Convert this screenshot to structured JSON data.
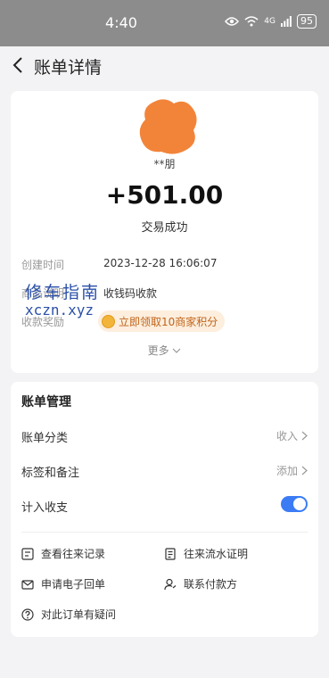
{
  "status_bar": {
    "time": "4:40",
    "network": "4G",
    "battery": "95"
  },
  "header": {
    "title": "账单详情"
  },
  "transaction": {
    "payer": "**朋",
    "amount": "+501.00",
    "status": "交易成功",
    "details": [
      {
        "label": "创建时间",
        "value": "2023-12-28 16:06:07"
      },
      {
        "label": "商品说明",
        "value": "收钱码收款"
      },
      {
        "label": "收款奖励",
        "value": ""
      }
    ],
    "reward_text": "立即领取10商家积分",
    "more_label": "更多"
  },
  "watermark": {
    "line1": "修车指南",
    "line2": "xczn.xyz"
  },
  "management": {
    "title": "账单管理",
    "category": {
      "label": "账单分类",
      "value": "收入"
    },
    "tags": {
      "label": "标签和备注",
      "value": "添加"
    },
    "count_in_budget": {
      "label": "计入收支",
      "enabled": true
    }
  },
  "actions": [
    {
      "label": "查看往来记录",
      "icon": "record-icon"
    },
    {
      "label": "往来流水证明",
      "icon": "statement-icon"
    },
    {
      "label": "申请电子回单",
      "icon": "mail-icon"
    },
    {
      "label": "联系付款方",
      "icon": "contact-icon"
    },
    {
      "label": "对此订单有疑问",
      "icon": "question-icon"
    }
  ],
  "colors": {
    "accent": "#3b7cf5",
    "reward_text": "#c0631a",
    "reward_bg": "#fdeedd",
    "avatar_mask": "#f2843a"
  }
}
